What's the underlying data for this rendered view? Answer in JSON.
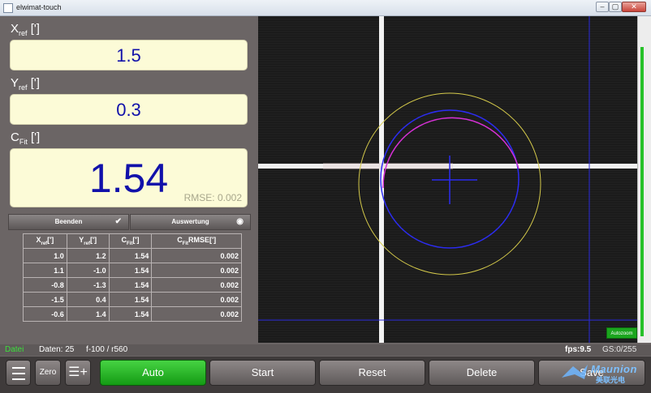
{
  "window": {
    "title": "elwimat-touch",
    "min": "–",
    "max": "▢",
    "close": "✕"
  },
  "fields": {
    "x": {
      "label_main": "X",
      "label_sub": "ref",
      "label_unit": " [']",
      "value": "1.5"
    },
    "y": {
      "label_main": "Y",
      "label_sub": "ref",
      "label_unit": " [']",
      "value": "0.3"
    },
    "c": {
      "label_main": "C",
      "label_sub": "Fit",
      "label_unit": " [']",
      "value": "1.54",
      "rmse": "RMSE: 0.002"
    }
  },
  "buttons": {
    "beenden": "Beenden",
    "beenden_icon": "✔",
    "auswertung": "Auswertung",
    "auswertung_icon": "👁",
    "zero": "Zero",
    "list_icon": "☰+",
    "auto": "Auto",
    "start": "Start",
    "reset": "Reset",
    "delete": "Delete",
    "save": "Save",
    "autozoom": "Autozoom"
  },
  "table": {
    "headers": [
      {
        "main": "X",
        "sub": "ref",
        "unit": "[']"
      },
      {
        "main": "Y",
        "sub": "ref",
        "unit": "[']"
      },
      {
        "main": "C",
        "sub": "Fit",
        "unit": "[']"
      },
      {
        "main": "C",
        "sub": "Fit",
        "unit": "RMSE[']"
      }
    ],
    "rows": [
      [
        "1.0",
        "1.2",
        "1.54",
        "0.002"
      ],
      [
        "1.1",
        "-1.0",
        "1.54",
        "0.002"
      ],
      [
        "-0.8",
        "-1.3",
        "1.54",
        "0.002"
      ],
      [
        "-1.5",
        "0.4",
        "1.54",
        "0.002"
      ],
      [
        "-0.6",
        "1.4",
        "1.54",
        "0.002"
      ]
    ]
  },
  "status": {
    "datei": "Datei",
    "daten": "Daten: 25",
    "f": "f-100 / r560",
    "fps": "fps:9.5",
    "gs": "GS:0/255"
  },
  "watermark": {
    "text": "Maunion",
    "cn": "美联光电"
  },
  "colors": {
    "accent_green": "#1ba51e",
    "value_blue": "#1111aa",
    "panel_bg": "#6b6565",
    "field_bg": "#fcfbd7"
  }
}
